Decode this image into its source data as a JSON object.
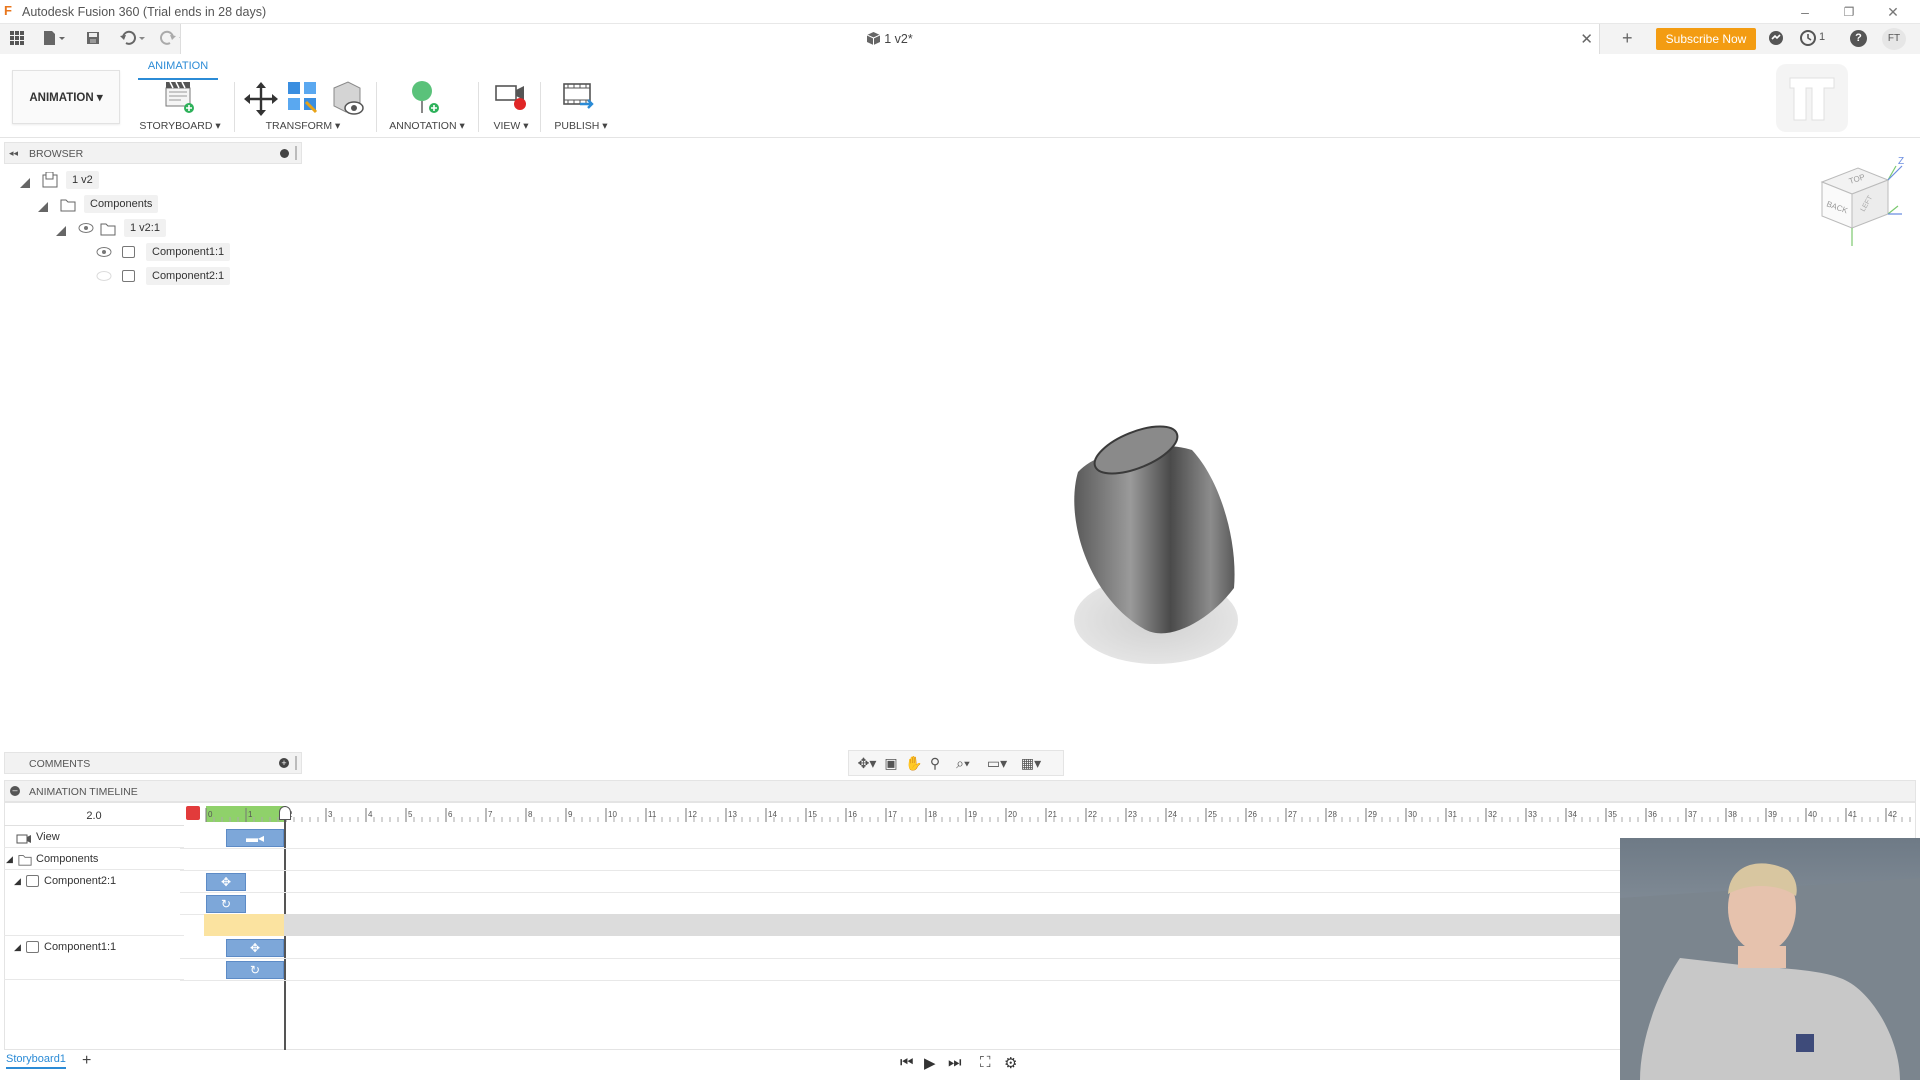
{
  "window": {
    "title": "Autodesk Fusion 360 (Trial ends in 28 days)",
    "minimize": "–",
    "restore": "❐",
    "close": "✕"
  },
  "document": {
    "tab_title": "1 v2*",
    "close": "✕",
    "new_tab": "+"
  },
  "header_right": {
    "subscribe_label": "Subscribe Now",
    "notifications": "1",
    "help": "?",
    "user_initials": "FT"
  },
  "ribbon": {
    "workspace_tab": "ANIMATION",
    "workspace_button": "ANIMATION",
    "groups": [
      {
        "label": "STORYBOARD"
      },
      {
        "label": "TRANSFORM"
      },
      {
        "label": "ANNOTATION"
      },
      {
        "label": "VIEW"
      },
      {
        "label": "PUBLISH"
      }
    ]
  },
  "browser": {
    "title": "BROWSER",
    "tree": [
      {
        "label": "1 v2"
      },
      {
        "label": "Components"
      },
      {
        "label": "1 v2:1"
      },
      {
        "label": "Component1:1"
      },
      {
        "label": "Component2:1"
      }
    ]
  },
  "comments": {
    "title": "COMMENTS"
  },
  "timeline": {
    "title": "ANIMATION TIMELINE",
    "current_time": "2.0",
    "rows": [
      {
        "label": "View"
      },
      {
        "label": "Components"
      },
      {
        "label": "Component2:1"
      },
      {
        "label": "Component1:1"
      }
    ],
    "ruler_ticks": [
      "0",
      "1",
      "2",
      "3",
      "4",
      "5",
      "6",
      "7",
      "8",
      "9",
      "10",
      "11",
      "12",
      "13",
      "14",
      "15",
      "16",
      "17",
      "18",
      "19",
      "20",
      "21",
      "22",
      "23",
      "24",
      "25",
      "26",
      "27",
      "28",
      "29",
      "30",
      "31",
      "32",
      "33",
      "34",
      "35",
      "36",
      "37",
      "38",
      "39",
      "40",
      "41",
      "42"
    ]
  },
  "storyboard": {
    "tab_label": "Storyboard1",
    "add": "+"
  },
  "viewcube": {
    "top": "TOP",
    "back": "BACK",
    "left": "LEFT",
    "axis_z": "Z"
  },
  "colors": {
    "accent": "#2b8bd6",
    "subscribe": "#f39c12",
    "keyframe_blue": "#7da7d9",
    "playhead_green": "#8fd16a"
  }
}
